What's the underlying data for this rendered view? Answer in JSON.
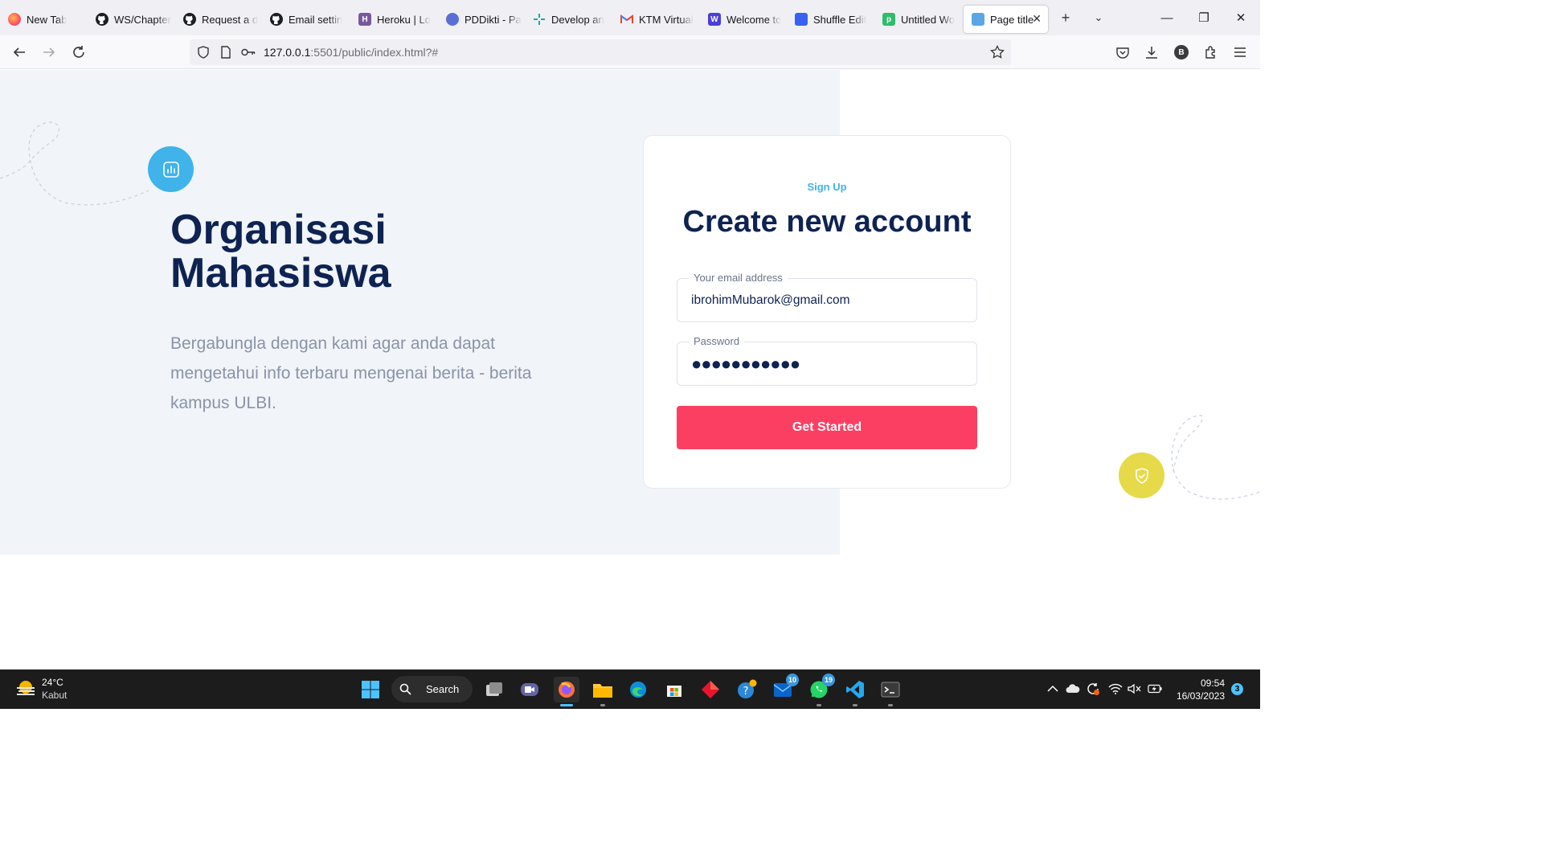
{
  "browser": {
    "tabs": [
      {
        "title": "New Tab",
        "icon": "firefox-icon",
        "color": "#ff7139"
      },
      {
        "title": "WS/Chapter",
        "icon": "github-icon",
        "color": "#1b1f23"
      },
      {
        "title": "Request a d",
        "icon": "github-icon",
        "color": "#1b1f23"
      },
      {
        "title": "Email settin",
        "icon": "github-icon",
        "color": "#1b1f23"
      },
      {
        "title": "Heroku | Lo",
        "icon": "heroku-icon",
        "color": "#79589f"
      },
      {
        "title": "PDDikti - Pa",
        "icon": "pddikti-icon",
        "color": "#5a6fd6"
      },
      {
        "title": "Develop an",
        "icon": "develop-icon",
        "color": "#17a8a8"
      },
      {
        "title": "KTM Virtual",
        "icon": "gmail-icon",
        "color": "#ea4335"
      },
      {
        "title": "Welcome to",
        "icon": "w-icon",
        "color": "#4a3fd9"
      },
      {
        "title": "Shuffle Edit",
        "icon": "shuffle-icon",
        "color": "#3761f0"
      },
      {
        "title": "Untitled Wo",
        "icon": "p-icon",
        "color": "#2ebd6b"
      },
      {
        "title": "Page title",
        "icon": "page-icon",
        "color": "#5ba7e6"
      }
    ],
    "tab_icon_letters": {
      "w": "W",
      "p": "p",
      "h": "H"
    },
    "url_host": "127.0.0.1",
    "url_path": ":5501/public/index.html?#",
    "profile_letter": "B"
  },
  "hero": {
    "title_line1": "Organisasi",
    "title_line2": "Mahasiswa",
    "description": "Bergabungla dengan kami agar anda dapat mengetahui info terbaru mengenai berita - berita kampus ULBI."
  },
  "signup": {
    "eyebrow": "Sign Up",
    "title": "Create new account",
    "email_label": "Your email address",
    "email_value": "ibrohimMubarok@gmail.com",
    "password_label": "Password",
    "password_mask": "●●●●●●●●●●●",
    "submit_label": "Get Started"
  },
  "colors": {
    "accent_blue": "#3fb3ea",
    "navy": "#0e2352",
    "cta": "#fb3f62",
    "shield_yellow": "#e6da4a",
    "panel_bg": "#f1f4f9"
  },
  "taskbar": {
    "weather_temp": "24°C",
    "weather_desc": "Kabut",
    "search_label": "Search",
    "outlook_badge": "10",
    "whatsapp_badge": "19",
    "time": "09:54",
    "date": "16/03/2023",
    "notification_count": "3"
  }
}
